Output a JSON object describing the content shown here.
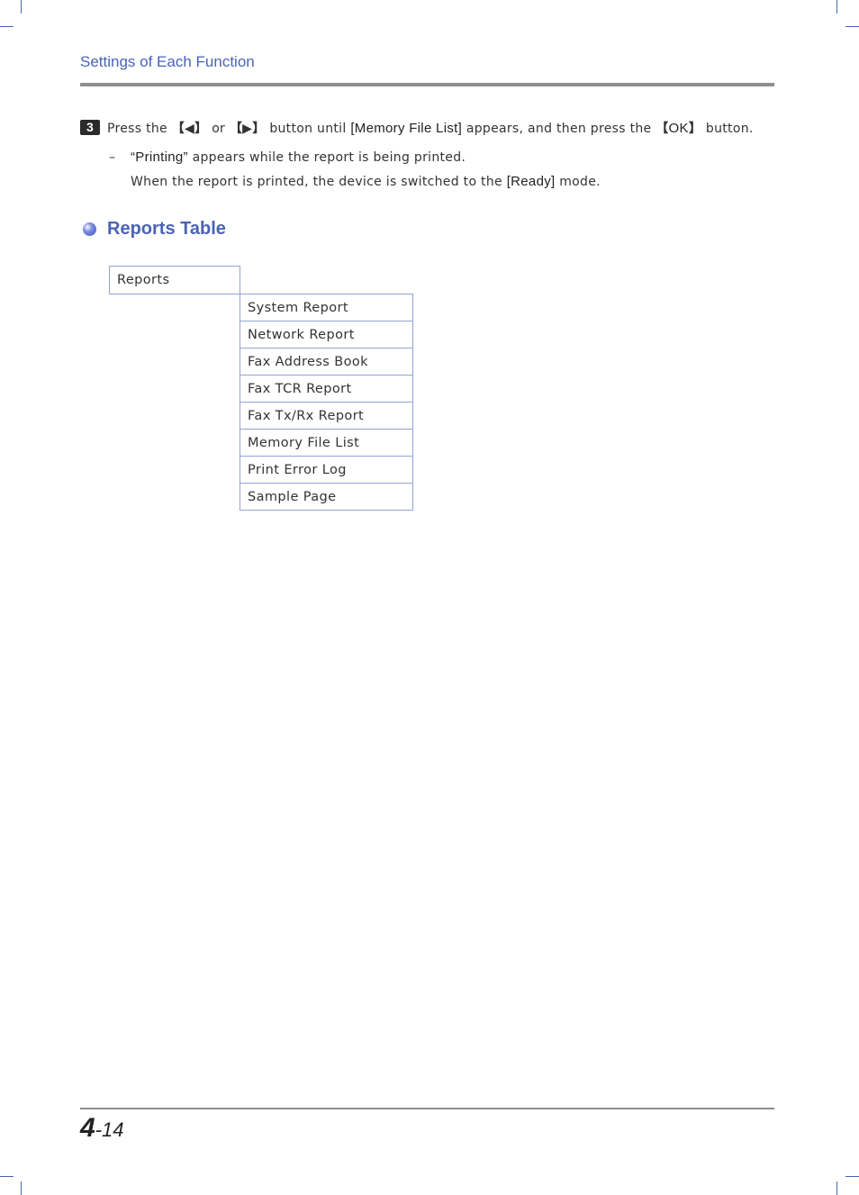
{
  "header": {
    "title": "Settings of Each Function"
  },
  "step": {
    "number": "3",
    "text_1": "Press the ",
    "left_key_open": "【",
    "left_key_icon": "◀",
    "left_key_close": "】",
    "text_2": " or ",
    "right_key_open": "【",
    "right_key_icon": "▶",
    "right_key_close": "】",
    "text_3": " button until ",
    "menu_term": "[Memory File List]",
    "text_4": " appears, and then press the ",
    "ok_key_open": "【",
    "ok_key": "OK",
    "ok_key_close": "】",
    "text_5": " button."
  },
  "note": {
    "dash": "–",
    "quoted_term": "“Printing”",
    "line1_rest": " appears while the report is being printed.",
    "line2_text": "When the report is printed, the device is switched to the ",
    "line2_term": "[Ready]",
    "line2_end": " mode."
  },
  "section": {
    "title": "Reports Table"
  },
  "reports_table": {
    "root": "Reports",
    "items": [
      "System Report",
      "Network Report",
      "Fax Address Book",
      "Fax TCR Report",
      "Fax Tx/Rx Report",
      "Memory File List",
      "Print Error Log",
      "Sample Page"
    ]
  },
  "footer": {
    "chapter": "4",
    "page": "-14"
  }
}
